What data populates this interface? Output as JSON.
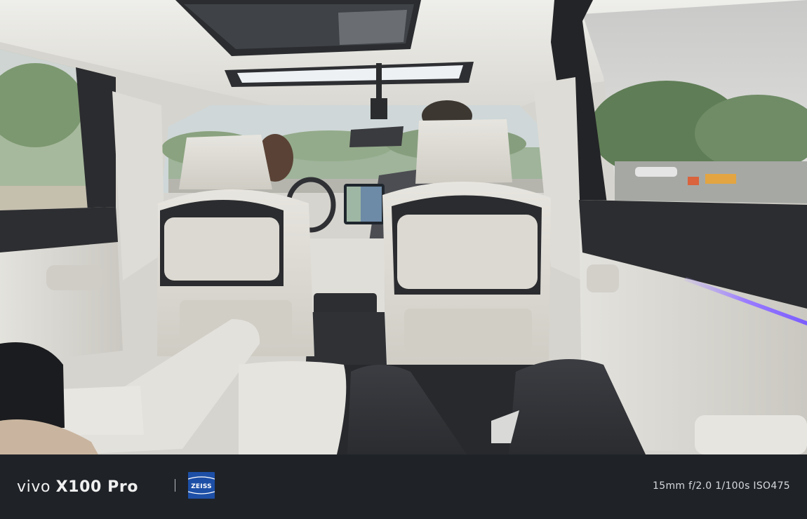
{
  "photo": {
    "scene": "car-interior-rear-seat-view"
  },
  "watermark": {
    "brand": "vivo",
    "model": "X100 Pro",
    "lens_brand": "ZEISS",
    "lens_logo_color": "#1d4fa6",
    "exif": "15mm  f/2.0  1/100s  ISO475"
  },
  "colors": {
    "bar_background": "#1f2328",
    "ambient_light": "#9a7cff"
  }
}
